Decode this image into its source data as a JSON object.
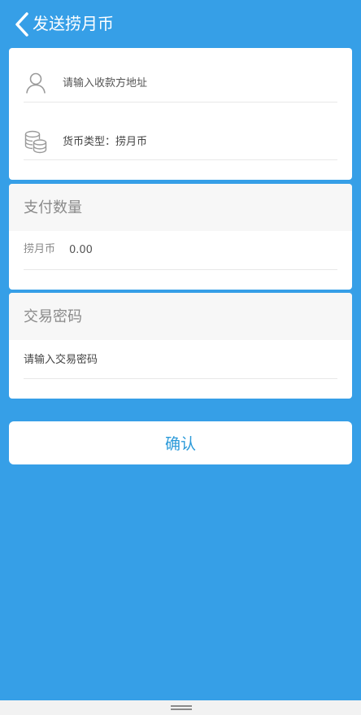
{
  "header": {
    "back_icon": "chevron-left-icon",
    "title": "发送捞月币"
  },
  "recipient": {
    "icon": "user-icon",
    "placeholder": "请输入收款方地址",
    "value": ""
  },
  "currency": {
    "icon": "coins-icon",
    "label": "货币类型：捞月币"
  },
  "payment": {
    "section_title": "支付数量",
    "unit": "捞月币",
    "amount": "0.00"
  },
  "password": {
    "section_title": "交易密码",
    "placeholder": "请输入交易密码"
  },
  "confirm": {
    "label": "确认"
  },
  "colors": {
    "background": "#369fe7",
    "accent": "#2b9ad9",
    "card": "#ffffff"
  }
}
